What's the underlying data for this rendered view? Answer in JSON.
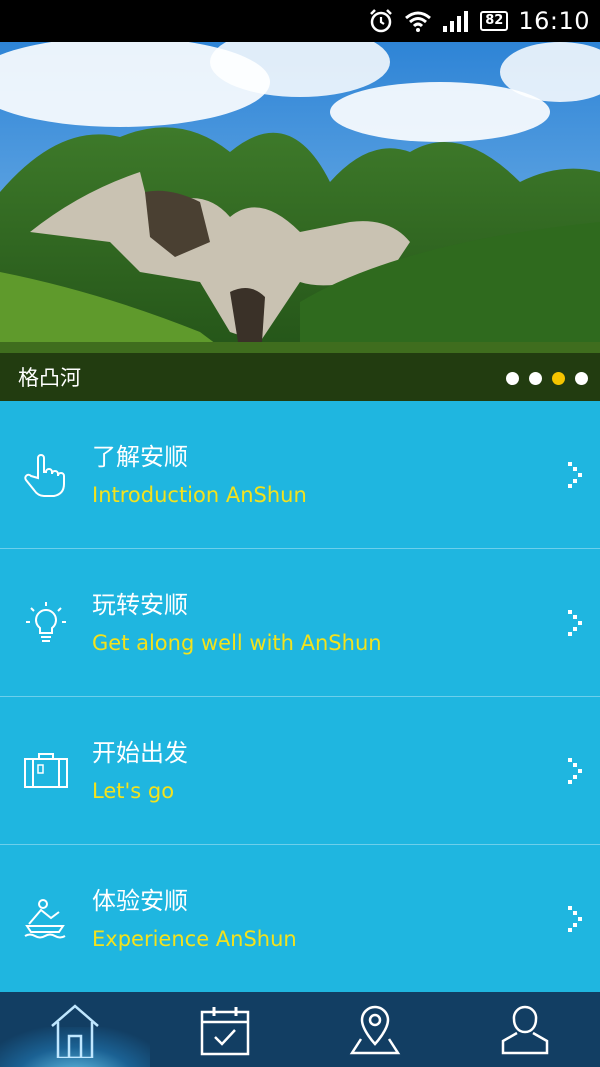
{
  "status_bar": {
    "battery": "82",
    "time": "16:10",
    "icons": [
      "alarm-icon",
      "wifi-icon",
      "signal-icon",
      "battery-icon"
    ]
  },
  "banner": {
    "caption": "格凸河",
    "slide_count": 4,
    "active_slide": 3
  },
  "menu": {
    "items": [
      {
        "title": "了解安顺",
        "subtitle": "Introduction AnShun",
        "icon": "hand-pointer-icon"
      },
      {
        "title": "玩转安顺",
        "subtitle": "Get along well with AnShun",
        "icon": "lightbulb-icon"
      },
      {
        "title": "开始出发",
        "subtitle": "Let's go",
        "icon": "suitcase-icon"
      },
      {
        "title": "体验安顺",
        "subtitle": "Experience AnShun",
        "icon": "rafting-icon"
      }
    ]
  },
  "bottom_nav": {
    "items": [
      "home-icon",
      "calendar-check-icon",
      "location-pin-icon",
      "user-icon"
    ],
    "active": 0
  },
  "colors": {
    "menu_background": "#1fb6e0",
    "subtitle": "#f4e21c",
    "nav_background": "#123e63",
    "active_dot": "#f5c400"
  }
}
